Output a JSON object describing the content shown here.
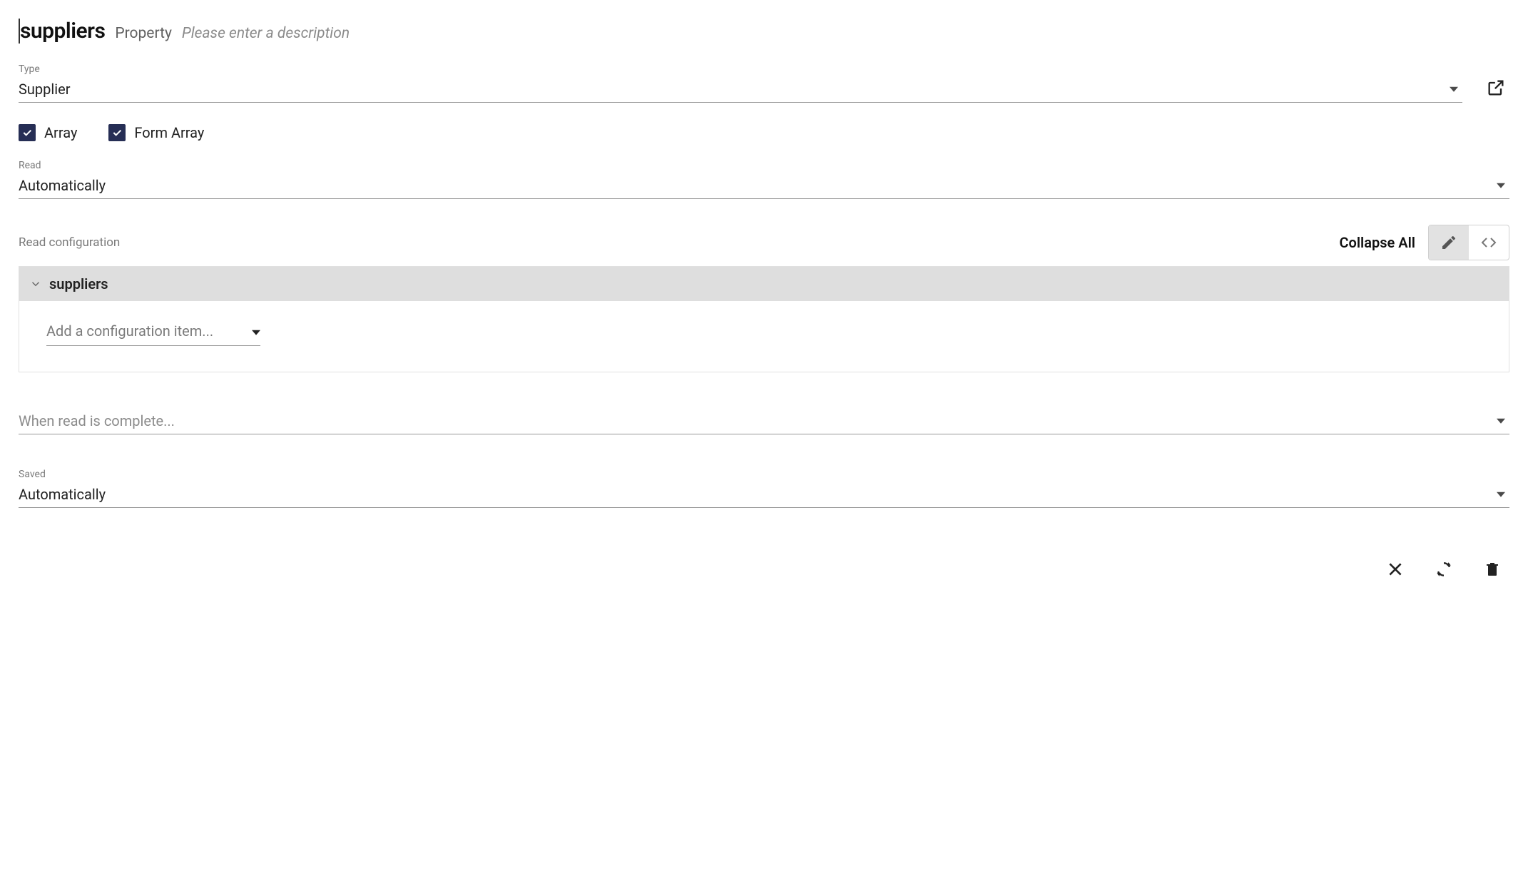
{
  "header": {
    "name": "suppliers",
    "kind": "Property",
    "description_placeholder": "Please enter a description"
  },
  "type": {
    "label": "Type",
    "value": "Supplier"
  },
  "checks": {
    "array_label": "Array",
    "array_checked": true,
    "formarray_label": "Form Array",
    "formarray_checked": true
  },
  "read": {
    "label": "Read",
    "value": "Automatically"
  },
  "read_config": {
    "label": "Read configuration",
    "collapse_label": "Collapse All",
    "node_title": "suppliers",
    "add_item_placeholder": "Add a configuration item..."
  },
  "when_complete": {
    "placeholder": "When read is complete..."
  },
  "saved": {
    "label": "Saved",
    "value": "Automatically"
  }
}
